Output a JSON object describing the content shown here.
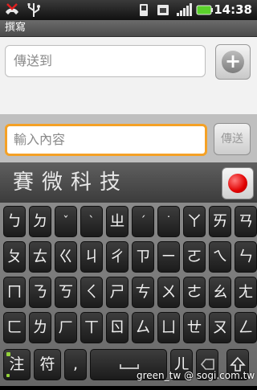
{
  "status_bar": {
    "time": "14:38",
    "icons": [
      "missed-call-icon",
      "usb-icon",
      "signal-icon",
      "sim-icon",
      "battery-icon"
    ],
    "battery_color": "#5ad12b"
  },
  "title_bar": {
    "title": "撰寫"
  },
  "to_field": {
    "placeholder": "傳送到"
  },
  "add_button": {
    "label": "+"
  },
  "message_field": {
    "placeholder": "輸入內容"
  },
  "send_button": {
    "label": "傳送"
  },
  "candidates": {
    "text": "賽微科技"
  },
  "record_button": {
    "color": "#e10000"
  },
  "keyboard": {
    "rows": [
      [
        "ㄅ",
        "ㄉ",
        "ˇ",
        "ˋ",
        "ㄓ",
        "ˊ",
        "˙",
        "ㄚ",
        "ㄞ",
        "ㄢ"
      ],
      [
        "ㄆ",
        "ㄊ",
        "ㄍ",
        "ㄐ",
        "ㄔ",
        "ㄗ",
        "ㄧ",
        "ㄛ",
        "ㄟ",
        "ㄣ"
      ],
      [
        "ㄇ",
        "ㄋ",
        "ㄎ",
        "ㄑ",
        "ㄕ",
        "ㄘ",
        "ㄨ",
        "ㄜ",
        "ㄠ",
        "ㄤ"
      ],
      [
        "ㄈ",
        "ㄌ",
        "ㄏ",
        "ㄒ",
        "ㄖ",
        "ㄙ",
        "ㄩ",
        "ㄝ",
        "ㄡ",
        "ㄥ"
      ]
    ],
    "bottom": {
      "mode_key": "注",
      "symbol_key": "符",
      "comma_key": ",",
      "er_key": "ㄦ",
      "shift_icon": "shift-icon",
      "accent_color": "#93d23a"
    }
  },
  "watermark": {
    "text": "green_tw  @ sogi.com.tw"
  }
}
